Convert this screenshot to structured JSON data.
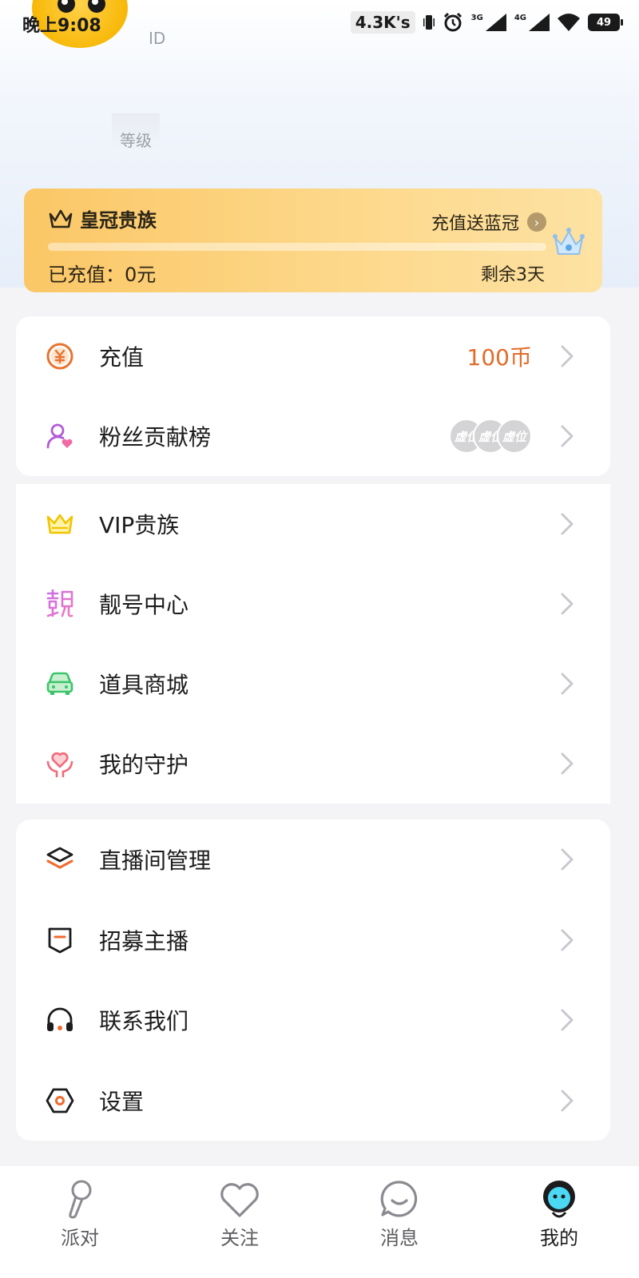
{
  "status_bar": {
    "time": "晚上9:08",
    "net_speed": "4.3K's",
    "signal_1": "3G",
    "signal_2": "4G",
    "battery": "49"
  },
  "profile": {
    "id_label": "ID",
    "level_label": "等级"
  },
  "crown_card": {
    "title": "皇冠贵族",
    "promo": "充值送蓝冠",
    "recharged": "已充值：0元",
    "remaining": "剩余3天",
    "progress": 0
  },
  "menu_groups": [
    {
      "items": [
        {
          "label": "充值",
          "value": "100币",
          "icon": "yuan-coin-icon"
        },
        {
          "label": "粉丝贡献榜",
          "icon": "fan-user-icon",
          "fans": [
            "虚位",
            "虚位",
            "虚位"
          ]
        }
      ]
    },
    {
      "items": [
        {
          "label": "VIP贵族",
          "icon": "crown-icon"
        },
        {
          "label": "靓号中心",
          "icon": "liang-char-icon"
        },
        {
          "label": "道具商城",
          "icon": "car-icon"
        },
        {
          "label": "我的守护",
          "icon": "heart-hands-icon"
        }
      ]
    },
    {
      "items": [
        {
          "label": "直播间管理",
          "icon": "layers-icon"
        },
        {
          "label": "招募主播",
          "icon": "shield-flag-icon"
        },
        {
          "label": "联系我们",
          "icon": "headphones-icon"
        },
        {
          "label": "设置",
          "icon": "hexagon-settings-icon"
        }
      ]
    }
  ],
  "bottom_nav": [
    {
      "label": "派对",
      "icon": "microphone-icon"
    },
    {
      "label": "关注",
      "icon": "heart-outline-icon"
    },
    {
      "label": "消息",
      "icon": "chat-bubble-icon"
    },
    {
      "label": "我的",
      "icon": "profile-avatar-icon",
      "active": true
    }
  ],
  "colors": {
    "accent_orange": "#e26b2a",
    "crown_gold_start": "#fbc766",
    "crown_gold_end": "#fde2a3",
    "chevron": "#c8c8d0"
  }
}
